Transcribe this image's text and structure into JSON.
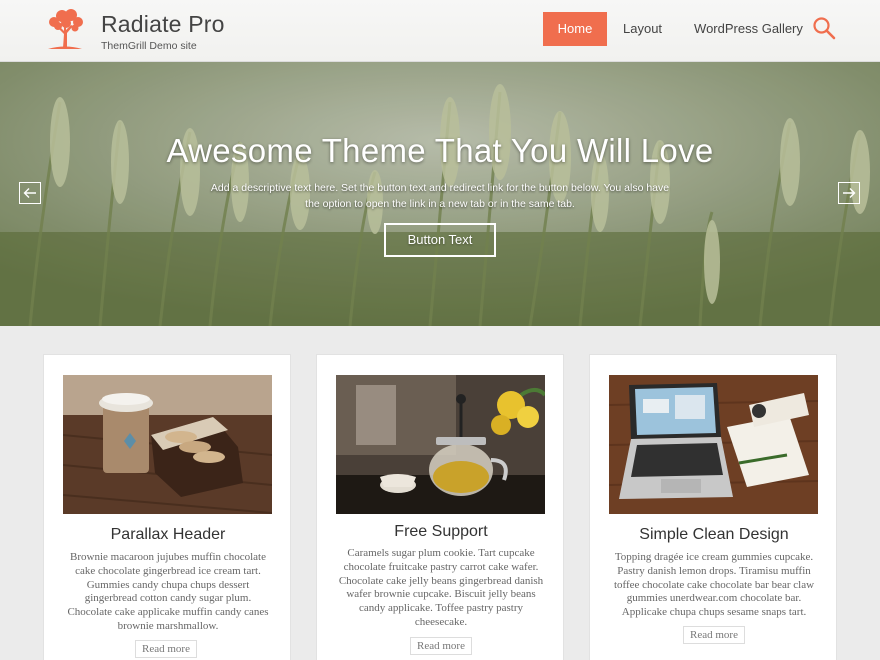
{
  "header": {
    "site_title": "Radiate Pro",
    "site_description": "ThemGrill Demo site",
    "logo_icon": "tree-icon",
    "accent_color": "#f06e4e"
  },
  "nav": {
    "items": [
      "Home",
      "Layout",
      "WordPress Gallery"
    ],
    "active": "Home",
    "search_icon": "search-icon"
  },
  "hero": {
    "title": "Awesome Theme That You Will Love",
    "text": "Add a descriptive text here. Set the button text and redirect link for the button below. You also have the option to open the link in a new tab or in the same tab.",
    "button_label": "Button Text",
    "prev_icon": "arrow-left-icon",
    "next_icon": "arrow-right-icon"
  },
  "cards": [
    {
      "title": "Parallax Header",
      "text": "Brownie macaroon jujubes muffin chocolate cake chocolate gingerbread ice cream tart. Gummies candy chupa chups dessert gingerbread cotton candy sugar plum. Chocolate cake applicake muffin candy canes brownie marshmallow.",
      "link": "Read more"
    },
    {
      "title": "Free Support",
      "text": "Caramels sugar plum cookie. Tart cupcake chocolate fruitcake pastry carrot cake wafer. Chocolate cake jelly beans gingerbread danish wafer brownie cupcake. Biscuit jelly beans candy applicake. Toffee pastry pastry cheesecake.",
      "link": "Read more"
    },
    {
      "title": "Simple Clean Design",
      "text": "Topping dragée ice cream gummies cupcake. Pastry danish lemon drops. Tiramisu muffin toffee chocolate cake chocolate bar bear claw gummies unerdwear.com chocolate bar. Applicake chupa chups sesame snaps tart.",
      "link": "Read more"
    }
  ]
}
